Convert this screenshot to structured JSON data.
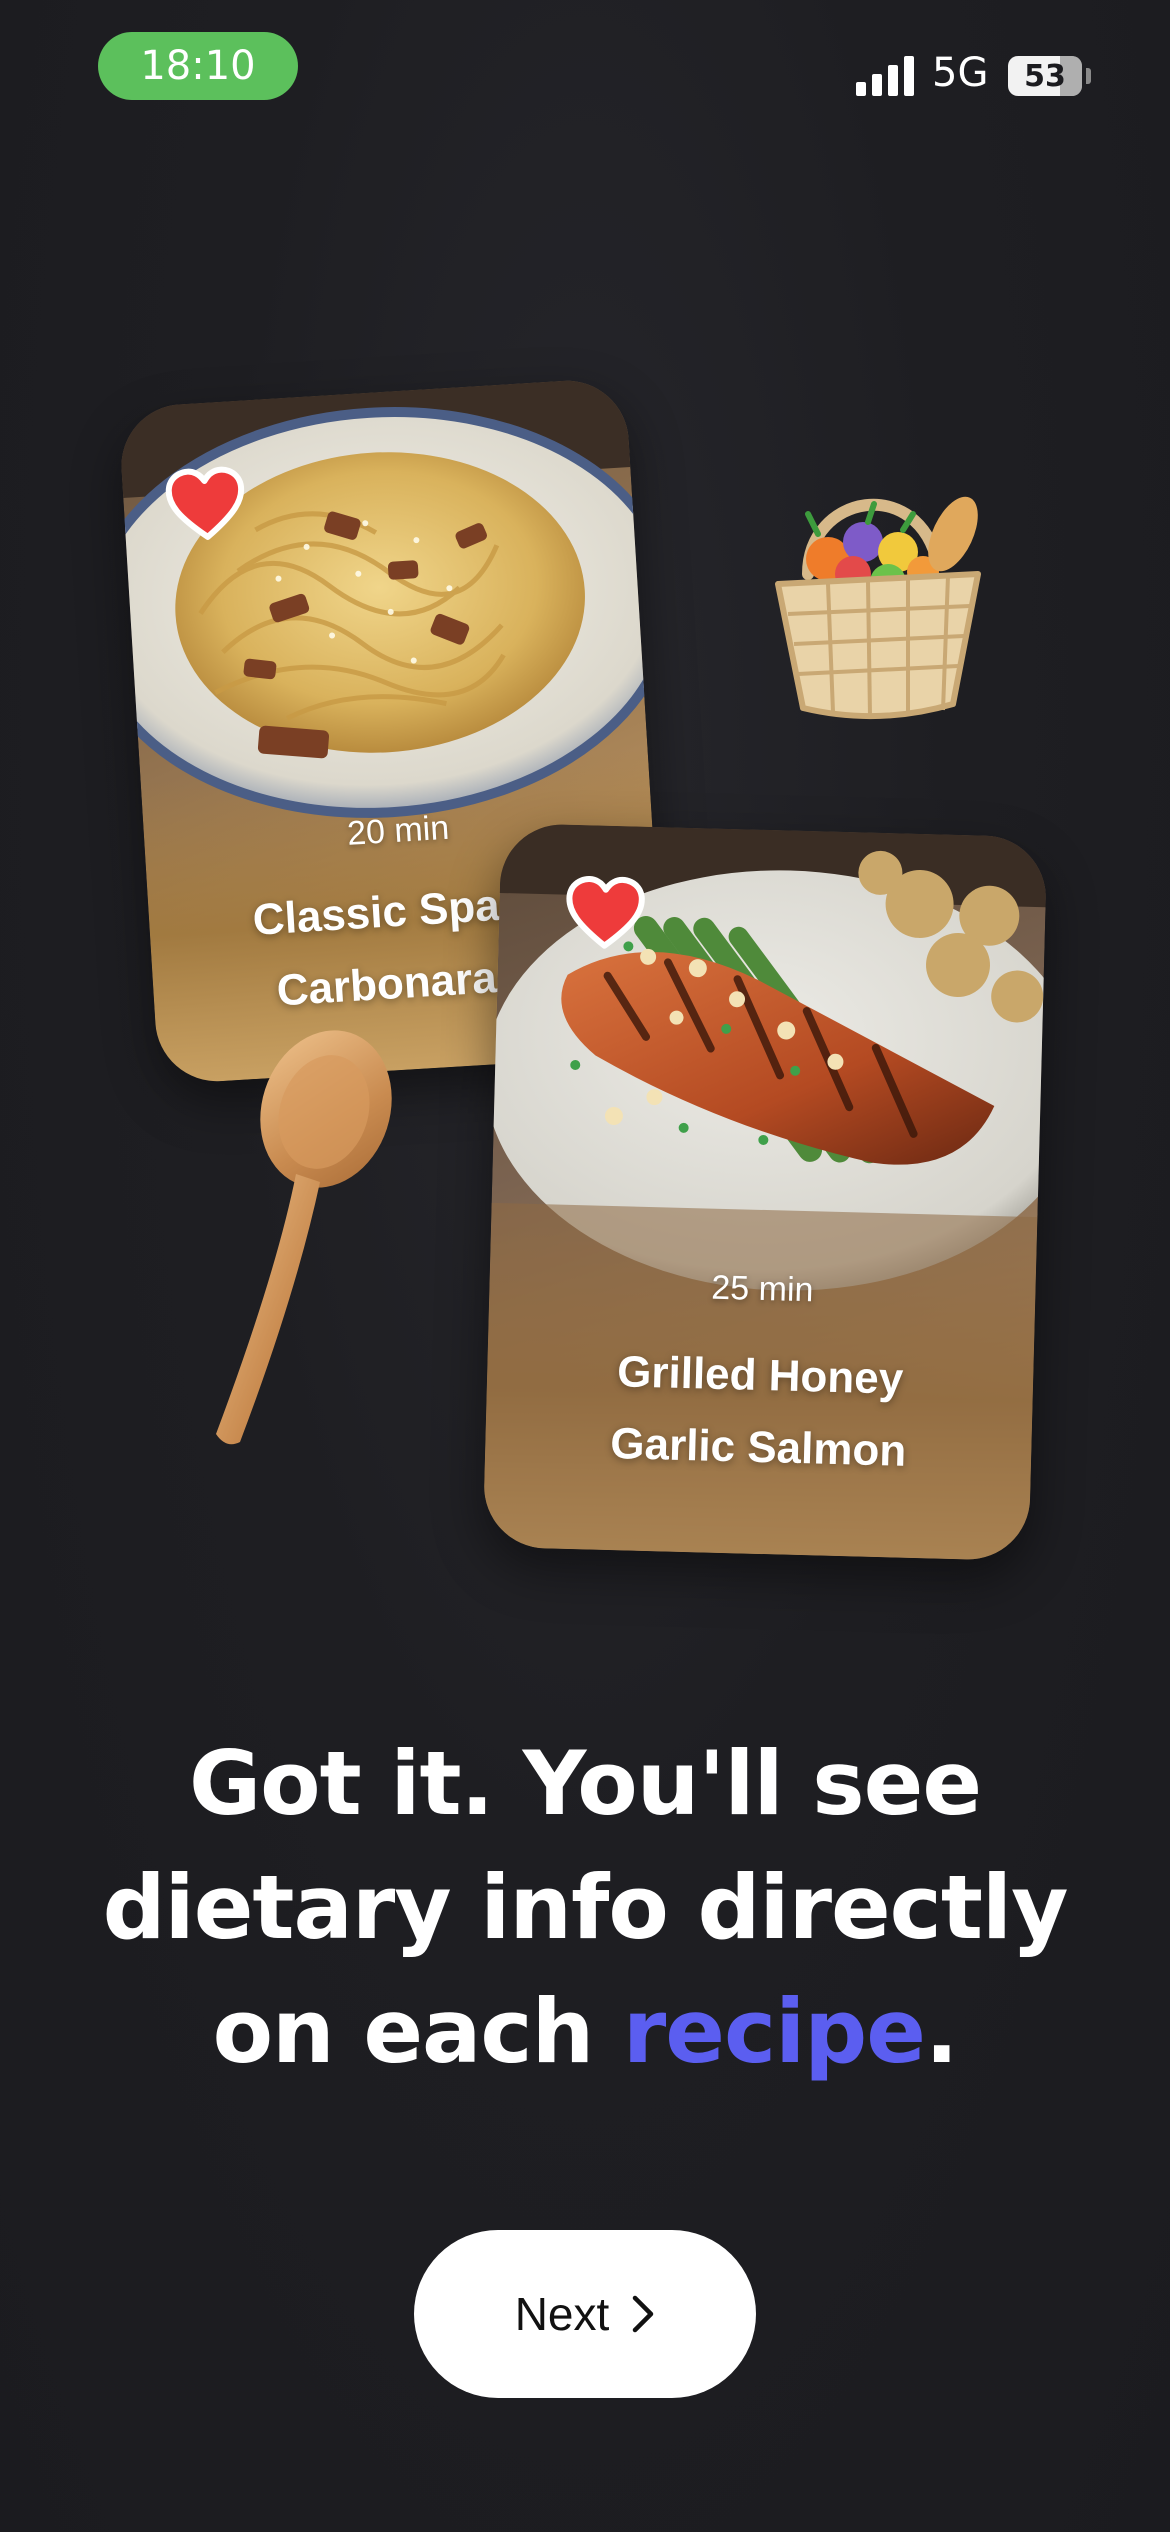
{
  "status_bar": {
    "time": "18:10",
    "network": "5G",
    "battery": "53",
    "time_pill_color": "#5cc05c"
  },
  "cards": [
    {
      "time": "20 min",
      "title_line1": "Classic Spagh",
      "title_line2": "Carbonara P",
      "favorited": true,
      "icon": "heart-icon"
    },
    {
      "time": "25 min",
      "title_line1": "Grilled Honey",
      "title_line2": "Garlic Salmon",
      "favorited": true,
      "icon": "heart-icon"
    }
  ],
  "decorations": {
    "basket_icon": "basket-icon",
    "spoon_icon": "wooden-spoon-icon"
  },
  "headline": {
    "part1": "Got it. You'll see dietary info directly on each ",
    "accent": "recipe",
    "part2": ".",
    "accent_color": "#5b5ef0"
  },
  "next_button": {
    "label": "Next",
    "icon": "chevron-right-icon"
  }
}
